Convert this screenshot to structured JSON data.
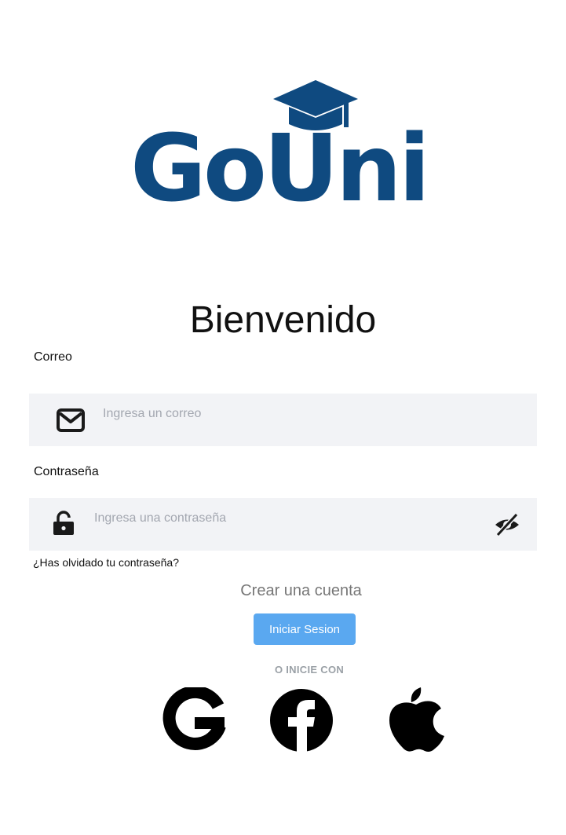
{
  "logo": {
    "text": "GoUni",
    "color": "#0f4a80"
  },
  "welcome": "Bienvenido",
  "email": {
    "label": "Correo",
    "placeholder": "Ingresa un correo",
    "icon": "mail-icon"
  },
  "password": {
    "label": "Contraseña",
    "placeholder": "Ingresa una contraseña",
    "icon": "lock-icon",
    "toggle_icon": "eye-off-icon"
  },
  "forgot_password": "¿Has olvidado tu contraseña?",
  "create_account": "Crear una cuenta",
  "login_button": "Iniciar Sesion",
  "or_sign_in_with": "O INICIE CON",
  "social": [
    "google-icon",
    "facebook-icon",
    "apple-icon"
  ],
  "colors": {
    "accent": "#5aa8f0",
    "input_bg": "#f2f3f6",
    "brand": "#0f4a80"
  }
}
